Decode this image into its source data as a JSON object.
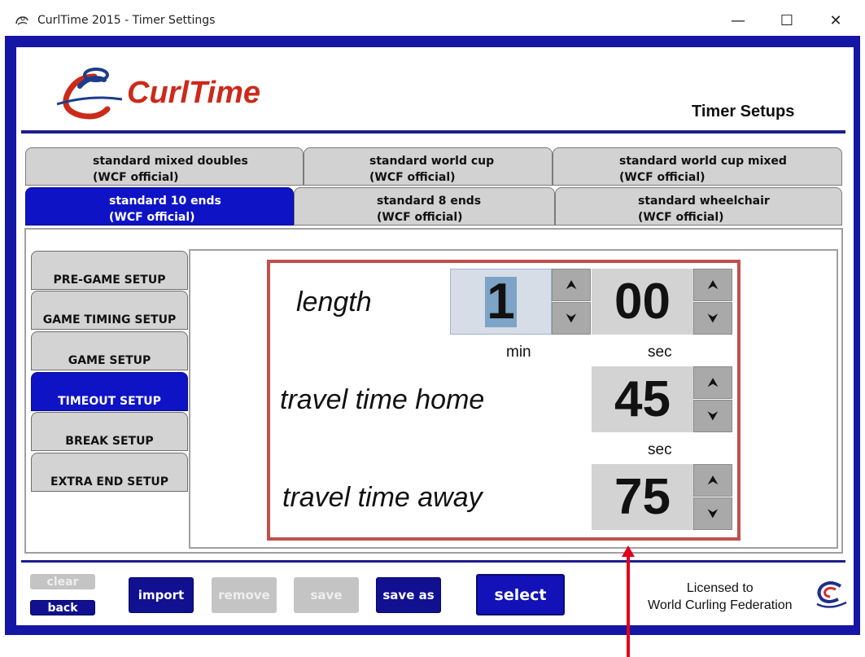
{
  "window": {
    "title": "CurlTime 2015 - Timer Settings",
    "controls": {
      "minimize": "—",
      "maximize": "☐",
      "close": "✕"
    }
  },
  "header": {
    "logo_text": "CurlTime",
    "title": "Timer Setups"
  },
  "tabs": [
    {
      "line1": "standard mixed doubles",
      "line2": "(WCF official)",
      "active": false
    },
    {
      "line1": "standard world cup",
      "line2": "(WCF official)",
      "active": false
    },
    {
      "line1": "standard world cup mixed",
      "line2": "(WCF official)",
      "active": false
    },
    {
      "line1": "standard 10 ends",
      "line2": "(WCF official)",
      "active": true
    },
    {
      "line1": "standard 8 ends",
      "line2": "(WCF official)",
      "active": false
    },
    {
      "line1": "standard wheelchair",
      "line2": "(WCF official)",
      "active": false
    }
  ],
  "sidebar": {
    "items": [
      {
        "label": "PRE-GAME SETUP",
        "active": false
      },
      {
        "label": "GAME TIMING SETUP",
        "active": false
      },
      {
        "label": "GAME SETUP",
        "active": false
      },
      {
        "label": "TIMEOUT SETUP",
        "active": true
      },
      {
        "label": "BREAK SETUP",
        "active": false
      },
      {
        "label": "EXTRA END SETUP",
        "active": false
      }
    ]
  },
  "settings": {
    "length": {
      "label": "length",
      "minutes": "1",
      "seconds": "00",
      "min_unit": "min",
      "sec_unit": "sec"
    },
    "travel_home": {
      "label": "travel time home",
      "seconds": "45",
      "sec_unit": "sec"
    },
    "travel_away": {
      "label": "travel time away",
      "seconds": "75"
    },
    "up_arrow": "⮝",
    "down_arrow": "⮟"
  },
  "bottom": {
    "clear": "clear",
    "back": "back",
    "import": "import",
    "remove": "remove",
    "save": "save",
    "save_as": "save as",
    "select": "select",
    "license_line1": "Licensed to",
    "license_line2": "World Curling Federation"
  },
  "colors": {
    "frame_blue": "#1515a6",
    "active_blue": "#0f13c6",
    "highlight_red": "#c0504d",
    "annotation_red": "#e0001b"
  }
}
